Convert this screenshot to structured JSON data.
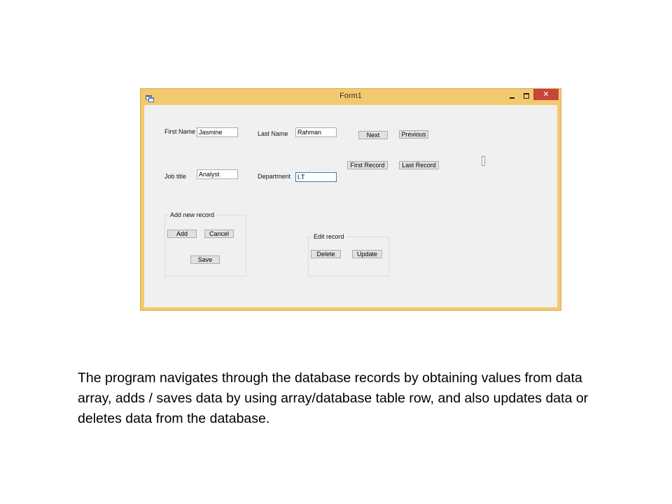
{
  "window": {
    "title": "Form1",
    "close_glyph": "✕"
  },
  "form": {
    "first_name_label": "First Name",
    "first_name_value": "Jasmine",
    "last_name_label": "Last Name",
    "last_name_value": "Rahman",
    "job_title_label": "Job title",
    "job_title_value": "Analyst",
    "department_label": "Department",
    "department_value": "I.T"
  },
  "nav": {
    "next_label": "Next",
    "previous_label": "Previous",
    "first_record_label": "First Record",
    "last_record_label": "Last Record"
  },
  "add_group": {
    "title": "Add new record",
    "add_label": "Add",
    "cancel_label": "Cancel",
    "save_label": "Save"
  },
  "edit_group": {
    "title": "Edit record",
    "delete_label": "Delete",
    "update_label": "Update"
  },
  "caption": "The program navigates through the database records by obtaining values from data array, adds / saves data by using array/database table row, and also updates data or deletes data from the database.",
  "colors": {
    "title_bar": "#f2c96e",
    "close_button": "#c7453b",
    "client_area": "#f0f0f0"
  },
  "icons": [
    "form-app-icon",
    "minimize-icon",
    "maximize-icon",
    "close-icon"
  ]
}
